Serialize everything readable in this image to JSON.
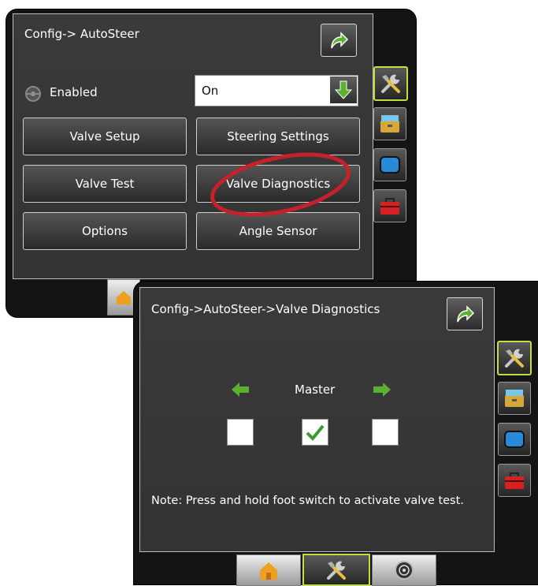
{
  "autosteer_screen": {
    "title": "Config-> AutoSteer",
    "enabled_label": "Enabled",
    "enabled_value": "On",
    "buttons": {
      "valve_setup": "Valve Setup",
      "steering_settings": "Steering Settings",
      "valve_test": "Valve Test",
      "valve_diagnostics": "Valve Diagnostics",
      "options": "Options",
      "angle_sensor": "Angle Sensor"
    },
    "highlight_color": "#c4222b"
  },
  "diagnostics_screen": {
    "title": "Config->AutoSteer->Valve Diagnostics",
    "master_label": "Master",
    "checkboxes": [
      {
        "name": "left",
        "checked": false
      },
      {
        "name": "master",
        "checked": true
      },
      {
        "name": "right",
        "checked": false
      }
    ],
    "note": "Note: Press and hold foot switch to activate valve test."
  },
  "side_tabs": [
    "tools-icon",
    "console-icon",
    "display-icon",
    "toolbox-icon"
  ],
  "bottom_tabs": [
    "home-icon",
    "tools-icon",
    "gauge-icon"
  ],
  "colors": {
    "accent_green": "#bfe040",
    "arrow_green": "#5bb030",
    "panel_bg": "#353535"
  }
}
